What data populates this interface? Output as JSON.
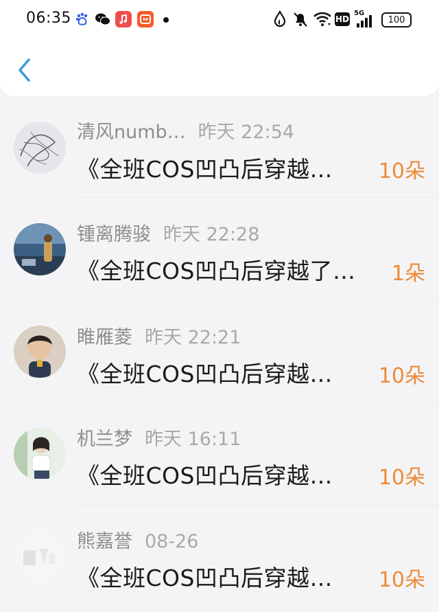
{
  "status_bar": {
    "time": "06:35",
    "apps": [
      "baidu-app-icon",
      "wechat-app-icon",
      "music-app-icon",
      "shopping-app-icon"
    ],
    "network": "5G",
    "hd_label": "HD",
    "battery": "100"
  },
  "header": {
    "back_icon": "chevron-left-icon",
    "accent_color": "#3a9ad9"
  },
  "colors": {
    "flowers": "#ee8a37",
    "meta": "#9a9a9a",
    "title": "#1a1a1a"
  },
  "items": [
    {
      "name": "清风numb…",
      "time": "昨天 22:54",
      "title": "《全班COS凹凸后穿越…",
      "flowers": "10朵",
      "avatar": "sketch-avatar"
    },
    {
      "name": "锺离腾骏",
      "time": "昨天 22:28",
      "title": "《全班COS凹凸后穿越了…",
      "flowers": "1朵",
      "avatar": "seaside-avatar"
    },
    {
      "name": "睢雁菱",
      "time": "昨天 22:21",
      "title": "《全班COS凹凸后穿越…",
      "flowers": "10朵",
      "avatar": "boy-avatar"
    },
    {
      "name": "机兰梦",
      "time": "昨天 16:11",
      "title": "《全班COS凹凸后穿越…",
      "flowers": "10朵",
      "avatar": "girl-avatar"
    },
    {
      "name": "熊嘉誉",
      "time": "08-26",
      "title": "《全班COS凹凸后穿越…",
      "flowers": "10朵",
      "avatar": "faded-avatar"
    }
  ]
}
